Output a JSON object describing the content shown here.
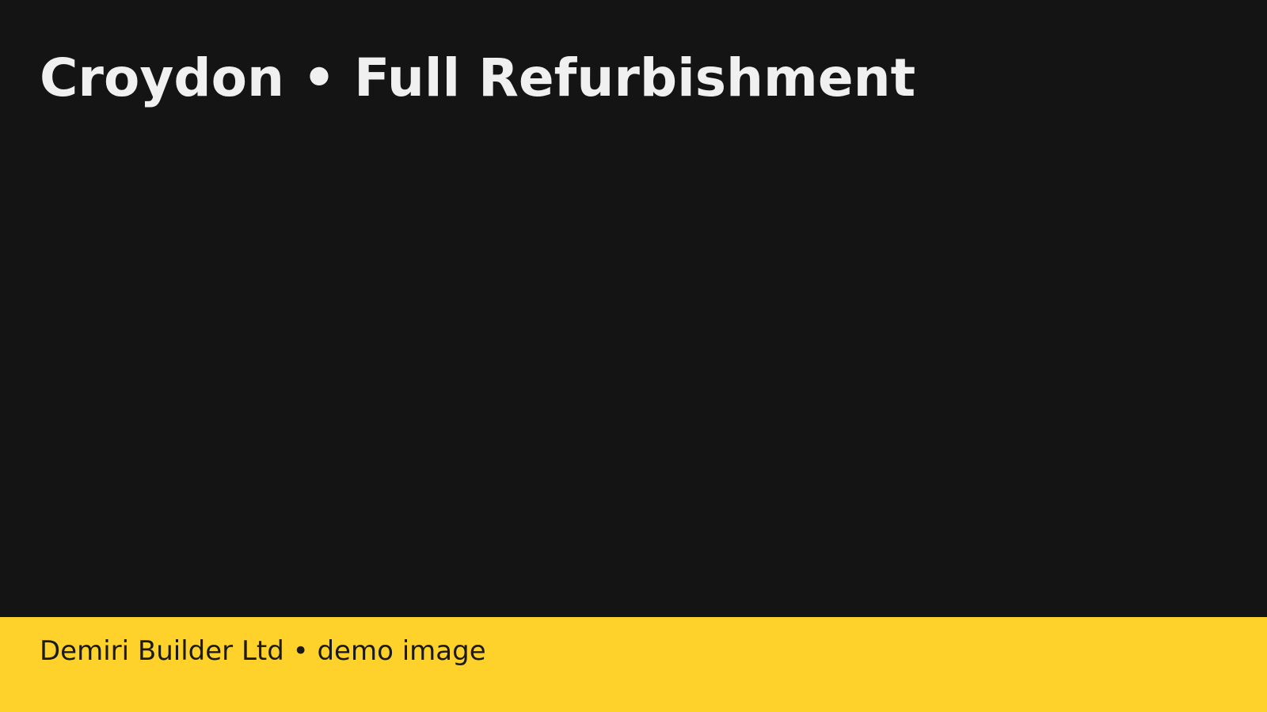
{
  "title": "Croydon • Full Refurbishment",
  "footer": {
    "caption": "Demiri Builder Ltd • demo image"
  },
  "colors": {
    "background": "#141414",
    "title_text": "#f0f0f0",
    "footer_bar": "#ffd22b",
    "footer_text": "#1a1a1a"
  }
}
